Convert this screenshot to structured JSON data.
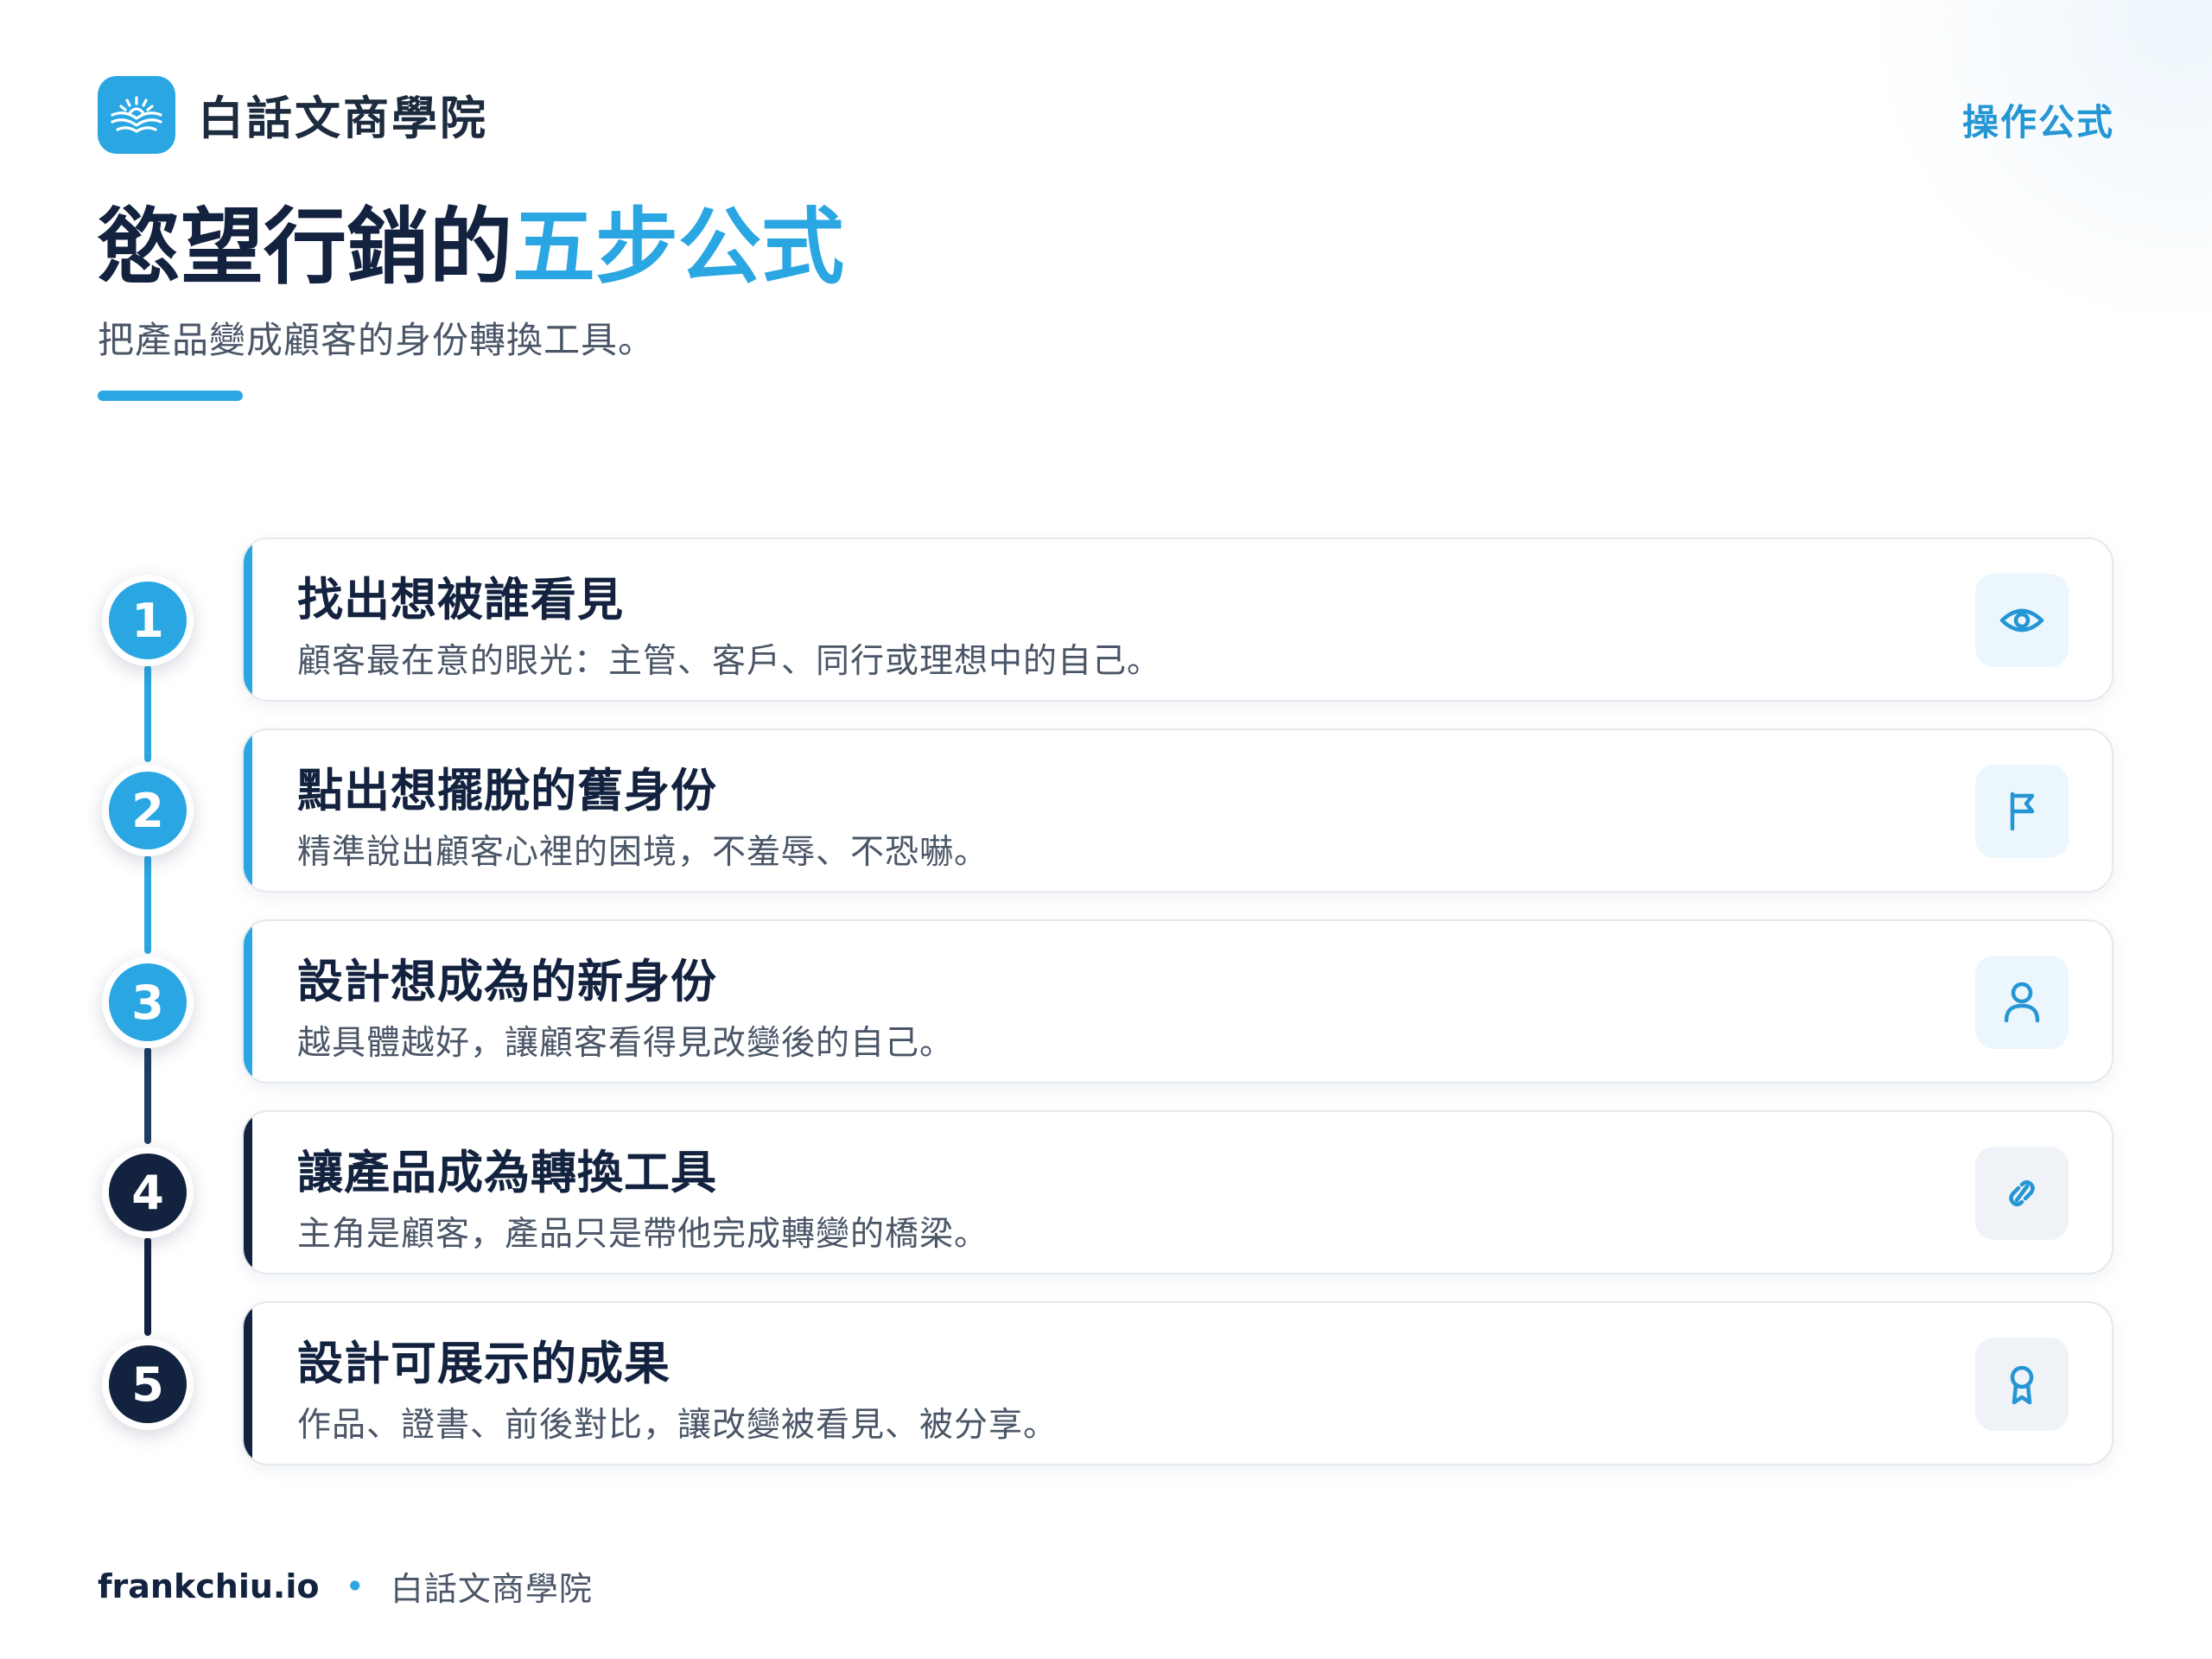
{
  "header": {
    "brand_name": "白話文商學院",
    "tag": "操作公式"
  },
  "title": {
    "main": "慾望行銷的",
    "accent": "五步公式",
    "subtitle": "把產品變成顧客的身份轉換工具。"
  },
  "steps": [
    {
      "number": "1",
      "title": "找出想被誰看見",
      "description": "顧客最在意的眼光：主管、客戶、同行或理想中的自己。",
      "icon": "eye-icon",
      "tone": "light"
    },
    {
      "number": "2",
      "title": "點出想擺脫的舊身份",
      "description": "精準說出顧客心裡的困境，不羞辱、不恐嚇。",
      "icon": "flag-icon",
      "tone": "light"
    },
    {
      "number": "3",
      "title": "設計想成為的新身份",
      "description": "越具體越好，讓顧客看得見改變後的自己。",
      "icon": "user-icon",
      "tone": "light"
    },
    {
      "number": "4",
      "title": "讓產品成為轉換工具",
      "description": "主角是顧客，產品只是帶他完成轉變的橋梁。",
      "icon": "link-icon",
      "tone": "dark"
    },
    {
      "number": "5",
      "title": "設計可展示的成果",
      "description": "作品、證書、前後對比，讓改變被看見、被分享。",
      "icon": "award-icon",
      "tone": "dark"
    }
  ],
  "footer": {
    "site": "frankchiu.io",
    "separator": "•",
    "name": "白話文商學院"
  },
  "colors": {
    "accent": "#2aa6e3",
    "navy": "#13223f",
    "text_muted": "#4a5667"
  }
}
